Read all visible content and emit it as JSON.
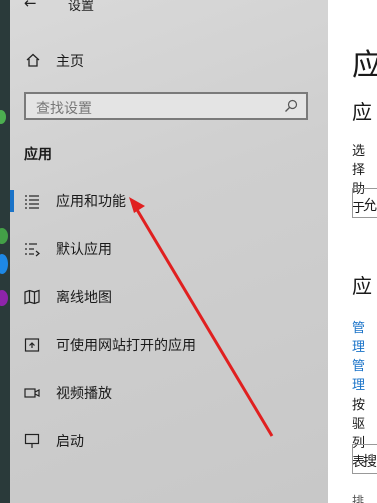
{
  "window": {
    "title": "设置",
    "back_icon": "back-arrow-icon"
  },
  "home": {
    "label": "主页",
    "icon": "home-icon"
  },
  "search": {
    "placeholder": "查找设置",
    "icon": "search-icon"
  },
  "section_title": "应用",
  "nav_items": [
    {
      "label": "应用和功能",
      "icon": "apps-list-icon",
      "active": true
    },
    {
      "label": "默认应用",
      "icon": "default-apps-icon"
    },
    {
      "label": "离线地图",
      "icon": "offline-map-icon"
    },
    {
      "label": "可使用网站打开的应用",
      "icon": "open-in-website-icon"
    },
    {
      "label": "视频播放",
      "icon": "video-icon"
    },
    {
      "label": "启动",
      "icon": "startup-icon"
    }
  ],
  "main": {
    "heading": "应",
    "subheading1": "应",
    "para1_line1": "选择",
    "para1_line2": "助于",
    "dropdown1": "允",
    "subheading2": "应",
    "link1": "管理",
    "link2": "管理",
    "para2_line1": "按驱",
    "para2_line2": "列表",
    "search_box": "搜",
    "sort": "排"
  },
  "colors": {
    "accent": "#1a73c8",
    "annotation_arrow": "#e02020"
  },
  "annotation": {
    "type": "arrow",
    "target": "应用和功能"
  }
}
